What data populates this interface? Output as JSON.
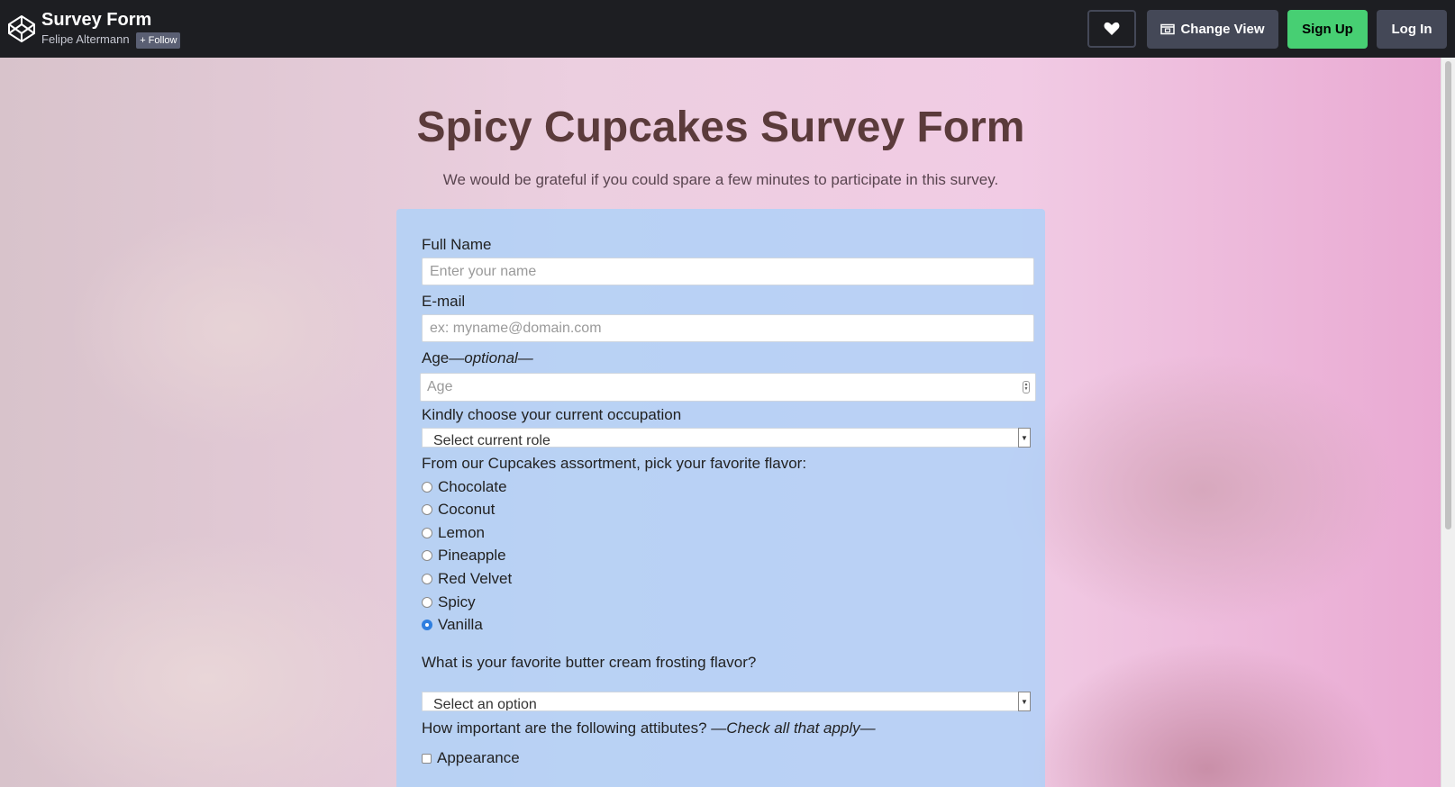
{
  "topbar": {
    "pen_title": "Survey Form",
    "author": "Felipe Altermann",
    "follow_label": "Follow",
    "change_view_label": "Change View",
    "signup_label": "Sign Up",
    "login_label": "Log In",
    "accent_green": "#47cf73",
    "icons": [
      "codepen-logo-icon",
      "plus-icon",
      "heart-icon",
      "change-view-icon"
    ]
  },
  "form": {
    "title": "Spicy Cupcakes Survey Form",
    "description": "We would be grateful if you could spare a few minutes to participate in this survey.",
    "name_label": "Full Name",
    "name_placeholder": "Enter your name",
    "email_label": "E-mail",
    "email_placeholder": "ex: myname@domain.com",
    "age_label": "Age",
    "age_optional": "—optional—",
    "age_placeholder": "Age",
    "occupation_label": "Kindly choose your current occupation",
    "occupation_selected": "Select current role",
    "flavor_label": "From our Cupcakes assortment, pick your favorite flavor:",
    "flavors": [
      {
        "label": "Chocolate",
        "checked": false
      },
      {
        "label": "Coconut",
        "checked": false
      },
      {
        "label": "Lemon",
        "checked": false
      },
      {
        "label": "Pineapple",
        "checked": false
      },
      {
        "label": "Red Velvet",
        "checked": false
      },
      {
        "label": "Spicy",
        "checked": false
      },
      {
        "label": "Vanilla",
        "checked": true
      }
    ],
    "frosting_label": "What is your favorite butter cream frosting flavor?",
    "frosting_selected": "Select an option",
    "attributes_label": "How important are the following attibutes? ",
    "attributes_hint": "—Check all that apply—",
    "attributes": [
      {
        "label": "Appearance",
        "checked": false
      }
    ]
  }
}
